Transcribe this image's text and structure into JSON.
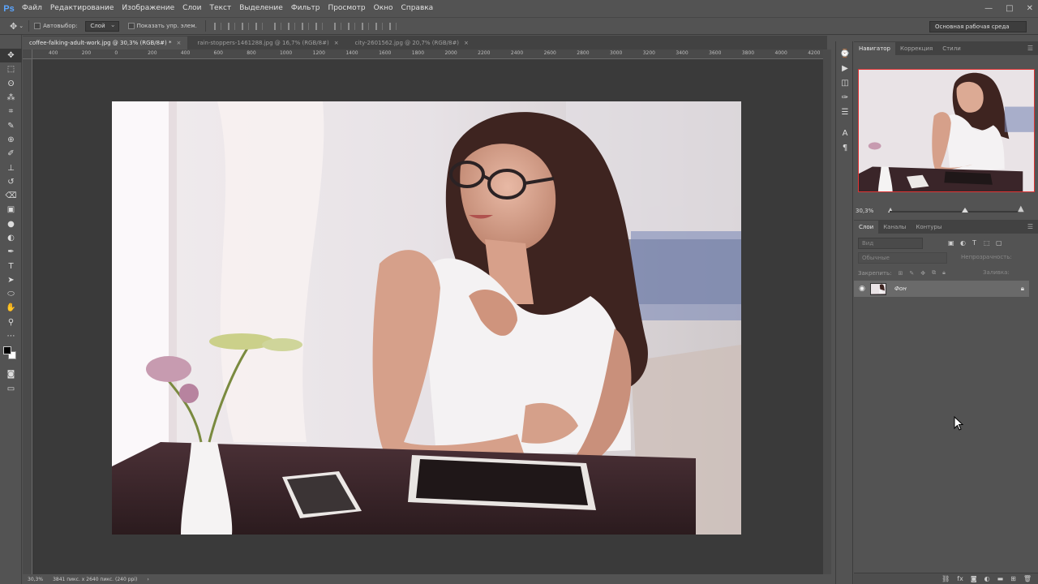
{
  "app": {
    "logo": "Ps"
  },
  "menu": [
    "Файл",
    "Редактирование",
    "Изображение",
    "Слои",
    "Текст",
    "Выделение",
    "Фильтр",
    "Просмотр",
    "Окно",
    "Справка"
  ],
  "window_controls": [
    "—",
    "□",
    "✕"
  ],
  "options_bar": {
    "move_icon": "move-icon",
    "auto_select_label": "Автовыбор:",
    "auto_select_value": "Слой",
    "show_transform_label": "Показать упр. элем.",
    "workspace": "Основная рабочая среда"
  },
  "tools": [
    "move",
    "marquee",
    "lasso",
    "magic-wand",
    "crop",
    "eyedropper",
    "healing",
    "brush",
    "stamp",
    "history-brush",
    "eraser",
    "gradient",
    "blur",
    "dodge",
    "pen",
    "type",
    "path-select",
    "shape",
    "hand",
    "zoom",
    "more"
  ],
  "tool_glyphs": [
    "✥",
    "⬚",
    "ʘ",
    "⁂",
    "⌗",
    "✎",
    "⊕",
    "✐",
    "⊥",
    "↺",
    "⌫",
    "▣",
    "●",
    "◐",
    "✒",
    "T",
    "➤",
    "⬭",
    "✋",
    "⚲",
    "⋯"
  ],
  "documents": [
    {
      "label": "coffee-falking-adult-work.jpg @ 30,3% (RGB/8#) *",
      "active": true
    },
    {
      "label": "rain-stoppers-1461288.jpg @ 16,7% (RGB/8#)",
      "active": false
    },
    {
      "label": "city-2601562.jpg @ 20,7% (RGB/8#)",
      "active": false
    }
  ],
  "ruler_h_labels": [
    "400",
    "200",
    "0",
    "200",
    "400",
    "600",
    "800",
    "1000",
    "1200",
    "1400",
    "1600",
    "1800",
    "2000",
    "2200",
    "2400",
    "2600",
    "2800",
    "3000",
    "3200",
    "3400",
    "3600",
    "3800",
    "4000",
    "4200"
  ],
  "status": {
    "zoom": "30,3%",
    "doc_info": "3841 пикс. x 2640 пикс. (240 ppi)"
  },
  "navigator": {
    "tabs": [
      "Навигатор",
      "Коррекция",
      "Стили"
    ],
    "zoom": "30,3%",
    "zoom_position": 0.58
  },
  "layers_panel": {
    "tabs": [
      "Слои",
      "Каналы",
      "Контуры"
    ],
    "search_placeholder": "Вид",
    "blend_mode": "Обычные",
    "opacity_label": "Непрозрачность:",
    "lock_label": "Закрепить:",
    "fill_label": "Заливка:",
    "layers": [
      {
        "name": "Фон",
        "visible": true,
        "locked": true
      }
    ]
  },
  "strip_icons": [
    "history-icon",
    "actions-icon",
    "adjust-icon",
    "brush-icon",
    "properties-icon",
    "character-icon",
    "paragraph-icon"
  ],
  "strip_glyphs": [
    "⌚",
    "▶",
    "◫",
    "✑",
    "☰",
    "A",
    "¶"
  ],
  "colors": {
    "accent_border": "#e03434",
    "panel_bg": "#535353",
    "canvas_bg": "#3a3a3a"
  }
}
